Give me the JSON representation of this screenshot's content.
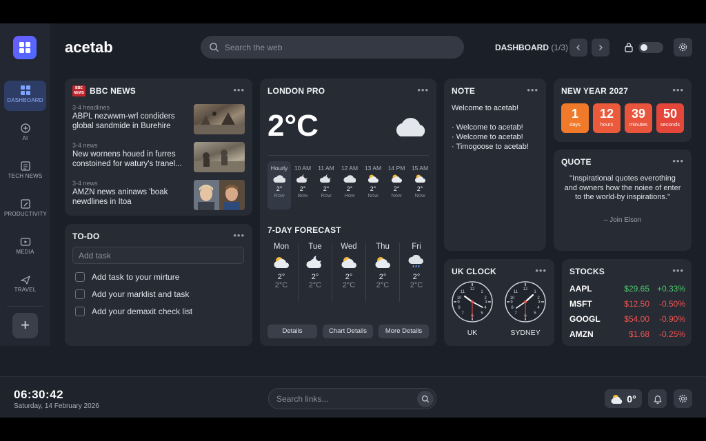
{
  "app": {
    "brand": "acetab"
  },
  "header": {
    "search_placeholder": "Search the web",
    "dashboard_label": "DASHBOARD",
    "dashboard_page": "(1/3)"
  },
  "sidebar": {
    "items": [
      {
        "label": "DASHBOARD",
        "icon": "dashboard-icon",
        "active": true
      },
      {
        "label": "AI",
        "icon": "ai-icon"
      },
      {
        "label": "TECH NEWS",
        "icon": "news-icon"
      },
      {
        "label": "PRODUCTIVITY",
        "icon": "edit-icon"
      },
      {
        "label": "MEDIA",
        "icon": "media-icon"
      },
      {
        "label": "TRAVEL",
        "icon": "plane-icon"
      }
    ],
    "add_label": "+"
  },
  "news": {
    "title": "BBC NEWS",
    "logo_text": "BBC NEWS",
    "items": [
      {
        "meta": "3-4 headlines",
        "title": "ABPL nezwwm-wrl condiders global sandmide in Burehire"
      },
      {
        "meta": "3-4 news",
        "title": "New wornens houed in furres constoined for watury's tranel..."
      },
      {
        "meta": "3-4 news",
        "title": "AMZN news aninaws 'boak newdlines in Itoa"
      }
    ]
  },
  "todo": {
    "title": "TO-DO",
    "placeholder": "Add task",
    "items": [
      "Add task to your mirture",
      "Add your marklist and task",
      "Add your demaxit check list"
    ]
  },
  "weather": {
    "title": "LONDON PRO",
    "temp": "2°C",
    "hourly": [
      {
        "time": "Hourly",
        "value": "2°",
        "status": "Row"
      },
      {
        "time": "10 AM",
        "value": "2°",
        "status": "Bow"
      },
      {
        "time": "11 AM",
        "value": "2°",
        "status": "Row"
      },
      {
        "time": "12 AM",
        "value": "2°",
        "status": "How"
      },
      {
        "time": "13 AM",
        "value": "2°",
        "status": "Now"
      },
      {
        "time": "14 PM",
        "value": "2°",
        "status": "Now"
      },
      {
        "time": "15 AM",
        "value": "2°",
        "status": "Now"
      }
    ],
    "forecast_title": "7-DAY FORECAST",
    "days": [
      {
        "day": "Mon",
        "high": "2°",
        "low": "2°C"
      },
      {
        "day": "Tue",
        "high": "2°",
        "low": "2°C"
      },
      {
        "day": "Wed",
        "high": "2°",
        "low": "2°C"
      },
      {
        "day": "Thu",
        "high": "2°",
        "low": "2°C"
      },
      {
        "day": "Fri",
        "high": "2°",
        "low": "2°C"
      }
    ],
    "buttons": [
      "Details",
      "Chart Details",
      "More Details"
    ]
  },
  "note": {
    "title": "NOTE",
    "welcome": "Welcome to acetab!",
    "lines": [
      "· Welcome to acetab!",
      "· Welcome to acetab!",
      "· Timogoose to acetab!"
    ]
  },
  "countdown": {
    "title": "NEW YEAR 2027",
    "units": [
      {
        "value": "1",
        "label": "days"
      },
      {
        "value": "12",
        "label": "hours"
      },
      {
        "value": "39",
        "label": "minutes"
      },
      {
        "value": "50",
        "label": "seconds"
      }
    ]
  },
  "quote": {
    "title": "QUOTE",
    "text": "\"Inspirational quotes everothing and owners how the noiee of enter to the world-by inspirations.\"",
    "author": "– Join Elson"
  },
  "clock_widget": {
    "title": "UK CLOCK",
    "clocks": [
      {
        "label": "UK"
      },
      {
        "label": "SYDNEY"
      }
    ]
  },
  "stocks": {
    "title": "STOCKS",
    "rows": [
      {
        "symbol": "AAPL",
        "price": "$29.65",
        "change": "+0.33%",
        "dir": "up"
      },
      {
        "symbol": "MSFT",
        "price": "$12.50",
        "change": "-0.50%",
        "dir": "down"
      },
      {
        "symbol": "GOOGL",
        "price": "$54.00",
        "change": "-0.90%",
        "dir": "down"
      },
      {
        "symbol": "AMZN",
        "price": "$1.68",
        "change": "-0.25%",
        "dir": "down"
      }
    ]
  },
  "bottom": {
    "time": "06:30:42",
    "date": "Saturday, 14 February 2026",
    "search_placeholder": "Search links...",
    "weather_temp": "0°"
  },
  "colors": {
    "accent": "#4d6bff",
    "countdown": [
      "#f07a2a",
      "#eb5a3a",
      "#e8543c",
      "#e4473a"
    ],
    "up": "#4cc96a",
    "down": "#ef5350"
  }
}
